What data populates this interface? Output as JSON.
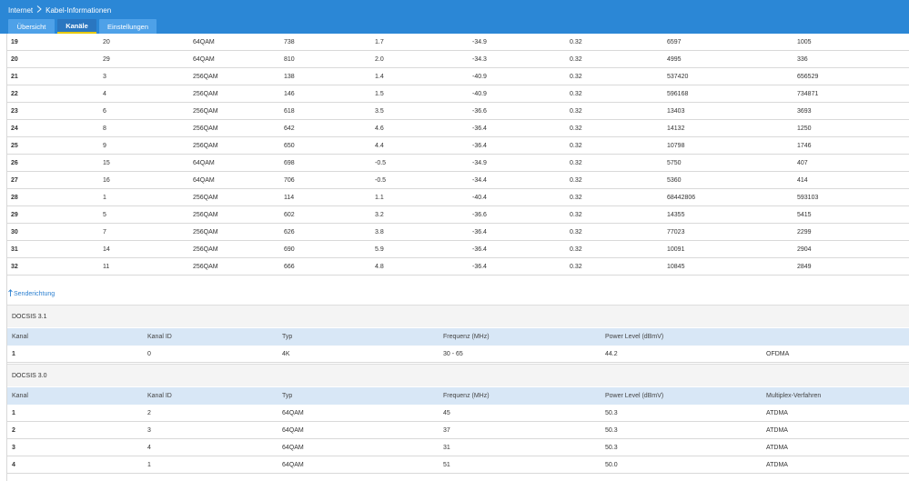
{
  "header": {
    "breadcrumb": [
      "Internet",
      "Kabel-Informationen"
    ],
    "separator_icon": "chevron-right-icon"
  },
  "tabs": [
    {
      "label": "Übersicht",
      "active": false
    },
    {
      "label": "Kanäle",
      "active": true
    },
    {
      "label": "Einstellungen",
      "active": false
    }
  ],
  "downstream": {
    "rows": [
      [
        "19",
        "20",
        "64QAM",
        "738",
        "1.7",
        "-34.9",
        "0.32",
        "6597",
        "1005"
      ],
      [
        "20",
        "29",
        "64QAM",
        "810",
        "2.0",
        "-34.3",
        "0.32",
        "4995",
        "336"
      ],
      [
        "21",
        "3",
        "256QAM",
        "138",
        "1.4",
        "-40.9",
        "0.32",
        "537420",
        "656529"
      ],
      [
        "22",
        "4",
        "256QAM",
        "146",
        "1.5",
        "-40.9",
        "0.32",
        "596168",
        "734871"
      ],
      [
        "23",
        "6",
        "256QAM",
        "618",
        "3.5",
        "-36.6",
        "0.32",
        "13403",
        "3693"
      ],
      [
        "24",
        "8",
        "256QAM",
        "642",
        "4.6",
        "-36.4",
        "0.32",
        "14132",
        "1250"
      ],
      [
        "25",
        "9",
        "256QAM",
        "650",
        "4.4",
        "-36.4",
        "0.32",
        "10798",
        "1746"
      ],
      [
        "26",
        "15",
        "64QAM",
        "698",
        "-0.5",
        "-34.9",
        "0.32",
        "5750",
        "407"
      ],
      [
        "27",
        "16",
        "64QAM",
        "706",
        "-0.5",
        "-34.4",
        "0.32",
        "5360",
        "414"
      ],
      [
        "28",
        "1",
        "256QAM",
        "114",
        "1.1",
        "-40.4",
        "0.32",
        "68442806",
        "593103"
      ],
      [
        "29",
        "5",
        "256QAM",
        "602",
        "3.2",
        "-36.6",
        "0.32",
        "14355",
        "5415"
      ],
      [
        "30",
        "7",
        "256QAM",
        "626",
        "3.8",
        "-36.4",
        "0.32",
        "77023",
        "2299"
      ],
      [
        "31",
        "14",
        "256QAM",
        "690",
        "5.9",
        "-36.4",
        "0.32",
        "10091",
        "2904"
      ],
      [
        "32",
        "11",
        "256QAM",
        "666",
        "4.8",
        "-36.4",
        "0.32",
        "10845",
        "2849"
      ]
    ]
  },
  "upstream": {
    "link_label": "Senderichtung",
    "link_icon": "arrow-up-icon",
    "docsis31": {
      "title": "DOCSIS 3.1",
      "headers": [
        "Kanal",
        "Kanal ID",
        "Typ",
        "Frequenz (MHz)",
        "Power Level (dBmV)",
        ""
      ],
      "rows": [
        [
          "1",
          "0",
          "4K",
          "30 - 65",
          "44.2",
          "OFDMA"
        ]
      ]
    },
    "docsis30": {
      "title": "DOCSIS 3.0",
      "headers": [
        "Kanal",
        "Kanal ID",
        "Typ",
        "Frequenz (MHz)",
        "Power Level (dBmV)",
        "Multiplex-Verfahren"
      ],
      "rows": [
        [
          "1",
          "2",
          "64QAM",
          "45",
          "50.3",
          "ATDMA"
        ],
        [
          "2",
          "3",
          "64QAM",
          "37",
          "50.3",
          "ATDMA"
        ],
        [
          "3",
          "4",
          "64QAM",
          "31",
          "50.3",
          "ATDMA"
        ],
        [
          "4",
          "1",
          "64QAM",
          "51",
          "50.0",
          "ATDMA"
        ]
      ]
    }
  },
  "colors": {
    "header": "#2b87d6",
    "tab": "#4ea1e8",
    "tab_active": "#2a76c0",
    "tab_active_underline": "#e6c800",
    "table_head": "#d8e7f6",
    "link": "#2b7fd0"
  }
}
